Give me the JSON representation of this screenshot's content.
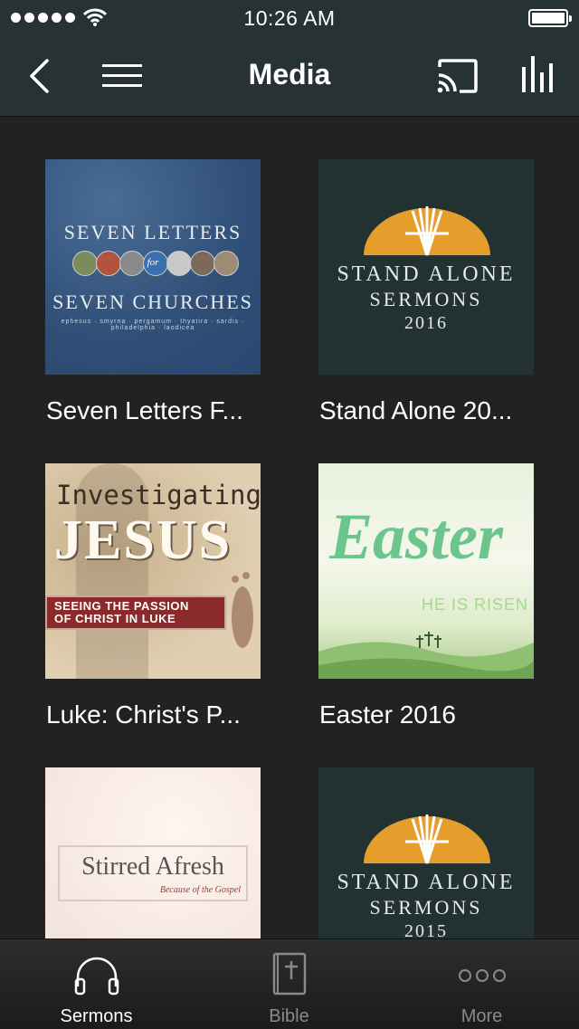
{
  "status_bar": {
    "time": "10:26 AM"
  },
  "nav": {
    "title": "Media"
  },
  "items": [
    {
      "title": "Seven Letters F...",
      "art": {
        "line1": "SEVEN LETTERS",
        "mid": "for",
        "line2": "SEVEN CHURCHES",
        "cities": "ephesus · smyrna · pergamum · thyatira · sardis · philadelphia · laodicea"
      }
    },
    {
      "title": "Stand Alone 20...",
      "art": {
        "line1": "STAND ALONE",
        "line2": "SERMONS",
        "year": "2016"
      }
    },
    {
      "title": "Luke: Christ's P...",
      "art": {
        "top": "Investigating",
        "big": "JESUS",
        "band1": "SEEING THE PASSION",
        "band2": "OF CHRIST IN LUKE"
      }
    },
    {
      "title": "Easter 2016",
      "art": {
        "word": "Easter",
        "sub": "HE IS RISEN"
      }
    },
    {
      "title": "",
      "art": {
        "main": "Stirred Afresh",
        "sub": "Because of the Gospel"
      }
    },
    {
      "title": "",
      "art": {
        "line1": "STAND ALONE",
        "line2": "SERMONS",
        "year": "2015"
      }
    }
  ],
  "tabs": [
    {
      "label": "Sermons",
      "active": true
    },
    {
      "label": "Bible",
      "active": false
    },
    {
      "label": "More",
      "active": false
    }
  ],
  "colors": {
    "nav_bg": "#263233",
    "grid_bg": "#222222",
    "active_tab": "#ffffff",
    "inactive_tab": "#8a8a8a"
  }
}
